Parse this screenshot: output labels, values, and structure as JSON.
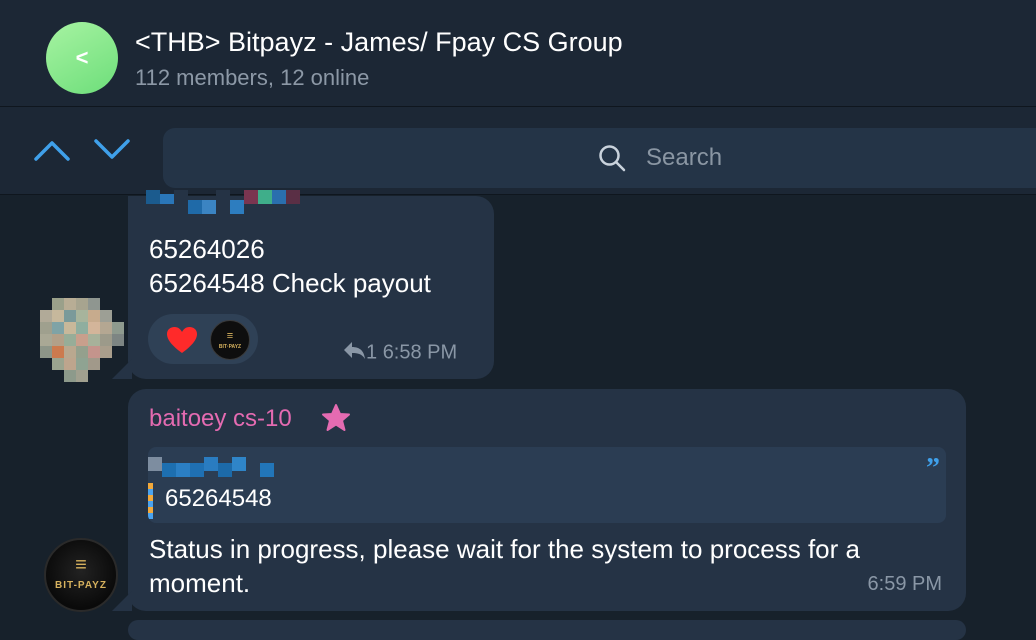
{
  "header": {
    "back_symbol": "<",
    "title": "<THB> Bitpayz - James/ Fpay CS Group",
    "subtitle": "112 members, 12 online"
  },
  "search": {
    "placeholder": "Search",
    "value": ""
  },
  "messages": [
    {
      "lines": [
        "65264026",
        "65264548 Check payout"
      ],
      "reactions": [
        "heart-icon",
        "bitpayz-avatar"
      ],
      "reply_count": "1",
      "time": "6:58 PM"
    },
    {
      "sender": "baitoey cs-10",
      "quote_text": "65264548",
      "body": "Status in progress, please wait for the system to process for a moment.",
      "time": "6:59 PM"
    }
  ],
  "brand": {
    "logo_text": "BIT-PAYZ",
    "logo_small_text": "BIT·PAYZ"
  },
  "colors": {
    "background": "#17212b",
    "bubble": "#253345",
    "sender": "#e46bb1",
    "accent": "#3fa0ea"
  }
}
